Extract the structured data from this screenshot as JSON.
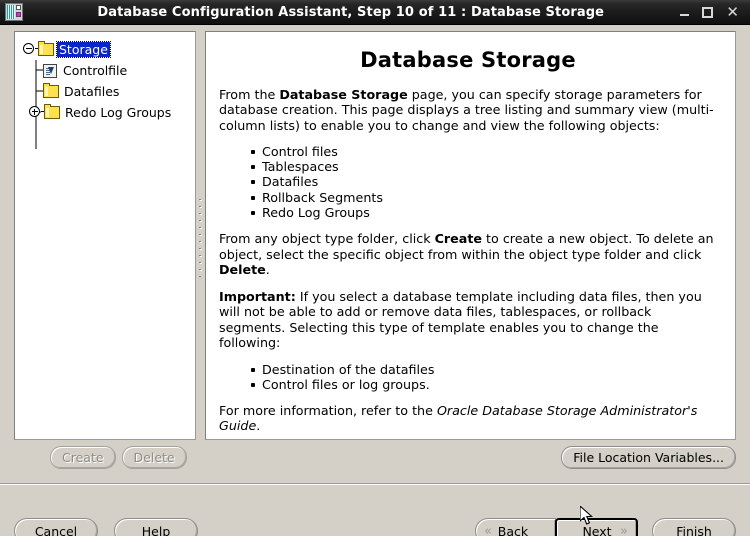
{
  "window": {
    "title": "Database Configuration Assistant, Step 10 of 11 : Database Storage",
    "app_icon": "database-app-icon",
    "controls": {
      "minimize": "minimize-icon",
      "maximize": "maximize-icon",
      "close": "close-icon"
    }
  },
  "tree": {
    "nodes": [
      {
        "label": "Storage",
        "icon": "folder-icon",
        "expanded": true,
        "selected": true,
        "toggle": "collapse-minus"
      },
      {
        "label": "Controlfile",
        "icon": "controlfile-icon",
        "expanded": false,
        "selected": false,
        "toggle": "none"
      },
      {
        "label": "Datafiles",
        "icon": "folder-icon",
        "expanded": false,
        "selected": false,
        "toggle": "none"
      },
      {
        "label": "Redo Log Groups",
        "icon": "folder-icon",
        "expanded": false,
        "selected": false,
        "toggle": "expand-plus"
      }
    ]
  },
  "content": {
    "title": "Database Storage",
    "intro_prefix": "From the ",
    "intro_bold": "Database Storage",
    "intro_suffix": " page, you can specify storage parameters for database creation. This page displays a tree listing and summary view (multi-column lists) to enable you to change and view the following objects:",
    "object_list": [
      "Control files",
      "Tablespaces",
      "Datafiles",
      "Rollback Segments",
      "Redo Log Groups"
    ],
    "create_delete_prefix": "From any object type folder, click ",
    "create_word": "Create",
    "create_delete_mid": " to create a new object. To delete an object, select the specific object from within the object type folder and click ",
    "delete_word": "Delete",
    "create_delete_suffix": ".",
    "important_label": "Important:",
    "important_text": " If you select a database template including data files, then you will not be able to add or remove data files, tablespaces, or rollback segments. Selecting this type of template enables you to change the following:",
    "change_list": [
      "Destination of the datafiles",
      "Control files or log groups."
    ],
    "more_info_prefix": "For more information, refer to the ",
    "more_info_italic": "Oracle Database Storage Administrator's Guide",
    "more_info_suffix": "."
  },
  "actions": {
    "create_label": "Create",
    "create_enabled": false,
    "delete_label": "Delete",
    "delete_enabled": false,
    "file_location_label": "File Location Variables..."
  },
  "navigation": {
    "cancel_label": "Cancel",
    "help_label": "Help",
    "back_label": "Back",
    "back_mnemonic": "B",
    "back_icon": "double-chevron-left-icon",
    "next_label": "Next",
    "next_mnemonic": "N",
    "next_icon": "double-chevron-right-icon",
    "next_focused": true,
    "finish_label": "Finish",
    "finish_mnemonic": "F"
  },
  "colors": {
    "window_bg": "#d4d0c8",
    "panel_bg": "#ffffff",
    "titlebar_dark": "#1b1b1b",
    "selection_blue": "#0a24c8",
    "folder_yellow": "#ffe14d",
    "disabled_text": "#8f8b86"
  }
}
